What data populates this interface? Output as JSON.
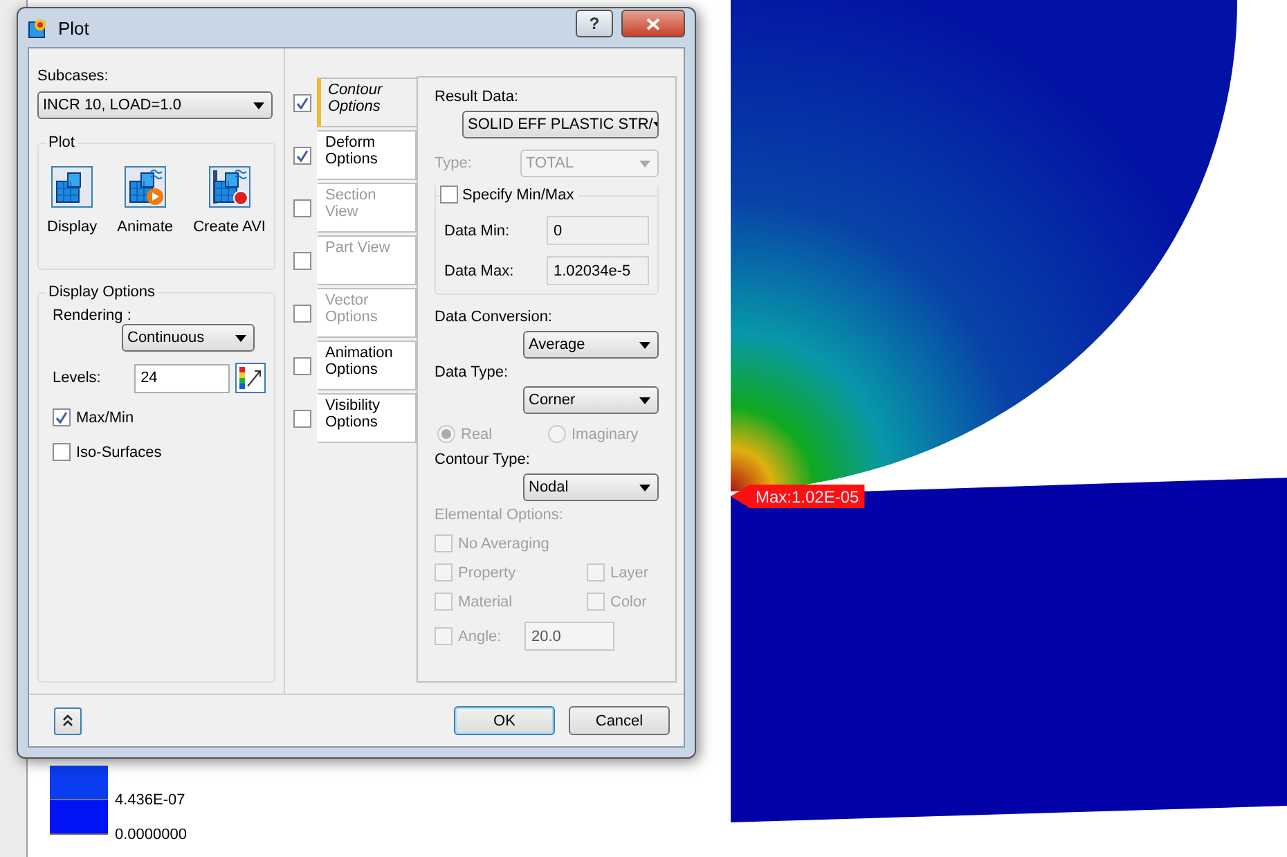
{
  "window": {
    "title": "Plot",
    "help": "?"
  },
  "subcases": {
    "label": "Subcases:",
    "value": "INCR 10, LOAD=1.0"
  },
  "plot_group": {
    "title": "Plot",
    "actions": [
      {
        "label": "Display",
        "kind": "display"
      },
      {
        "label": "Animate",
        "kind": "animate"
      },
      {
        "label": "Create AVI",
        "kind": "avi"
      }
    ]
  },
  "display_options": {
    "title": "Display Options",
    "rendering_label": "Rendering :",
    "rendering": "Continuous",
    "levels_label": "Levels:",
    "levels": "24",
    "checks": [
      {
        "label": "Max/Min",
        "checked": true
      },
      {
        "label": "Iso-Surfaces",
        "checked": false
      }
    ]
  },
  "tabs": [
    {
      "label": "Contour Options",
      "selected": true,
      "checked": true,
      "disabled": false
    },
    {
      "label": "Deform Options",
      "selected": false,
      "checked": true,
      "disabled": false
    },
    {
      "label": "Section View",
      "selected": false,
      "checked": false,
      "disabled": true
    },
    {
      "label": "Part View",
      "selected": false,
      "checked": false,
      "disabled": true
    },
    {
      "label": "Vector Options",
      "selected": false,
      "checked": false,
      "disabled": true
    },
    {
      "label": "Animation Options",
      "selected": false,
      "checked": false,
      "disabled": false
    },
    {
      "label": "Visibility Options",
      "selected": false,
      "checked": false,
      "disabled": false
    }
  ],
  "contour": {
    "result_data_label": "Result Data:",
    "result_data": "SOLID EFF PLASTIC STR/",
    "type_label": "Type:",
    "type": "TOTAL",
    "type_disabled": true,
    "specify": {
      "label": "Specify Min/Max",
      "checked": false
    },
    "data_min_label": "Data Min:",
    "data_min": "0",
    "data_max_label": "Data Max:",
    "data_max": "1.02034e-5",
    "conversion_label": "Data Conversion:",
    "conversion": "Average",
    "data_type_label": "Data Type:",
    "data_type": "Corner",
    "radios": [
      {
        "label": "Real",
        "selected": true
      },
      {
        "label": "Imaginary",
        "selected": false
      }
    ],
    "radios_disabled": true,
    "contour_type_label": "Contour Type:",
    "contour_type": "Nodal",
    "elemental": {
      "label": "Elemental Options:",
      "disabled": true,
      "options": [
        {
          "label": "No Averaging",
          "checked": false
        },
        {
          "label": "Property",
          "checked": false
        },
        {
          "label": "Layer",
          "checked": false
        },
        {
          "label": "Material",
          "checked": false
        },
        {
          "label": "Color",
          "checked": false
        }
      ],
      "angle": {
        "label": "Angle:",
        "checked": false,
        "value": "20.0"
      }
    }
  },
  "buttons": [
    {
      "label": "OK",
      "default": true
    },
    {
      "label": "Cancel",
      "default": false
    }
  ],
  "viewport": {
    "legend": [
      {
        "value": "4.436E-07",
        "color": "#0a3cf0"
      },
      {
        "value": "0.0000000",
        "color": "#0014f5"
      }
    ],
    "max_label": "Max:1.02E-05"
  }
}
